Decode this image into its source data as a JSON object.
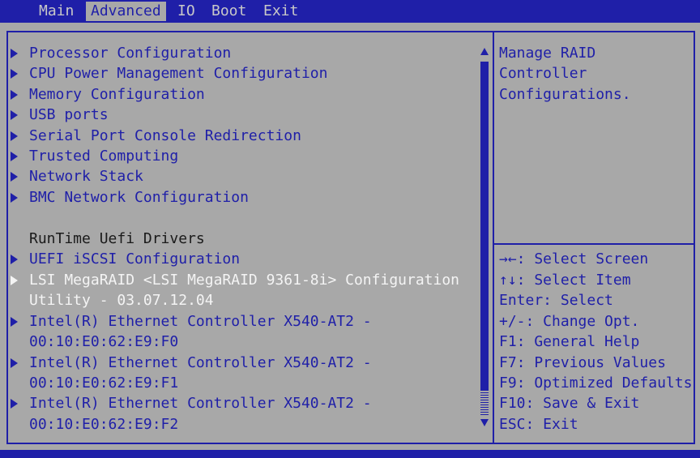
{
  "menu": {
    "tabs": [
      "Main",
      "Advanced",
      "IO",
      "Boot",
      "Exit"
    ],
    "active": "Advanced"
  },
  "list": {
    "items": [
      "Processor Configuration",
      "CPU Power Management Configuration",
      "Memory Configuration",
      "USB ports",
      "Serial Port Console Redirection",
      "Trusted Computing",
      "Network Stack",
      "BMC Network Configuration"
    ],
    "section_header": "RunTime Uefi Drivers",
    "drivers": [
      {
        "line1": "UEFI iSCSI Configuration",
        "line2": ""
      },
      {
        "line1": "LSI MegaRAID <LSI MegaRAID 9361-8i> Configuration",
        "line2": "Utility - 03.07.12.04"
      },
      {
        "line1": "Intel(R) Ethernet Controller X540-AT2 -",
        "line2": "00:10:E0:62:E9:F0"
      },
      {
        "line1": "Intel(R) Ethernet Controller X540-AT2 -",
        "line2": "00:10:E0:62:E9:F1"
      },
      {
        "line1": "Intel(R) Ethernet Controller X540-AT2 -",
        "line2": "00:10:E0:62:E9:F2"
      }
    ],
    "selected_driver_index": 1
  },
  "help": {
    "description": [
      "Manage RAID",
      "Controller",
      "Configurations."
    ],
    "keys": [
      "→←: Select Screen",
      "↑↓: Select Item",
      "Enter: Select",
      "+/-: Change Opt.",
      "F1: General Help",
      "F7: Previous Values",
      "F9: Optimized Defaults",
      "F10: Save & Exit",
      "ESC: Exit"
    ]
  },
  "colors": {
    "background": "#a8a8a8",
    "accent": "#1f1fa8",
    "selected_text": "#f4f4f4"
  }
}
